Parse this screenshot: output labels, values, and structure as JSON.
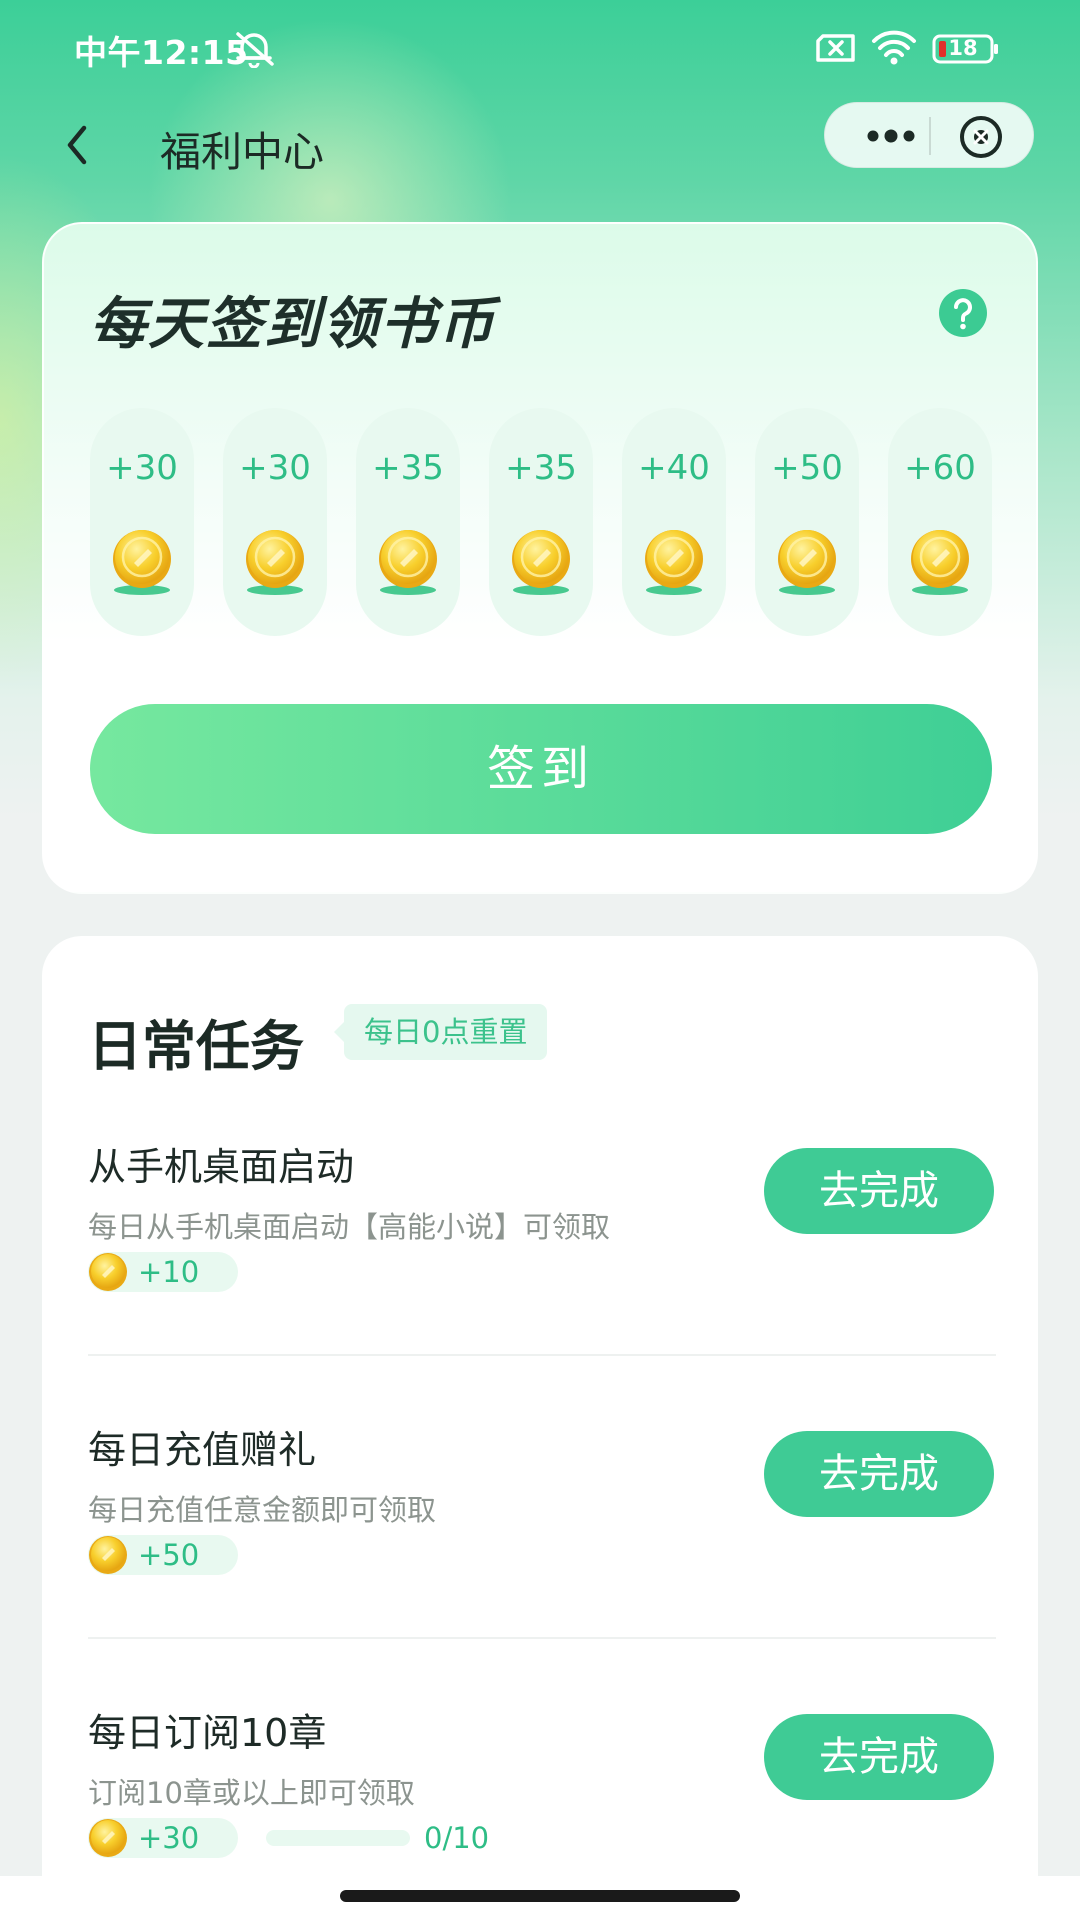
{
  "status_bar": {
    "time": "中午12:15",
    "battery": "18",
    "icons": [
      "bell-off-icon",
      "sim-x-icon",
      "wifi-icon",
      "battery-icon"
    ]
  },
  "nav": {
    "title": "福利中心",
    "back_icon": "chevron-left-icon",
    "more_icon": "more-dots-icon",
    "close_icon": "close-circle-icon"
  },
  "signin": {
    "title": "每天签到领书币",
    "help_icon": "question-circle-icon",
    "days": [
      {
        "value": "+30"
      },
      {
        "value": "+30"
      },
      {
        "value": "+35"
      },
      {
        "value": "+35"
      },
      {
        "value": "+40"
      },
      {
        "value": "+50"
      },
      {
        "value": "+60"
      }
    ],
    "button_label": "签到"
  },
  "tasks": {
    "title": "日常任务",
    "reset_badge": "每日0点重置",
    "items": [
      {
        "title": "从手机桌面启动",
        "desc": "每日从手机桌面启动【高能小说】可领取",
        "reward": "+10",
        "button_label": "去完成"
      },
      {
        "title": "每日充值赠礼",
        "desc": "每日充值任意金额即可领取",
        "reward": "+50",
        "button_label": "去完成"
      },
      {
        "title": "每日订阅10章",
        "desc": "订阅10章或以上即可领取",
        "reward": "+30",
        "button_label": "去完成",
        "progress_text": "0/10",
        "progress_fraction": 0
      }
    ]
  },
  "colors": {
    "accent": "#3fcb95",
    "accent_text": "#2ebd86",
    "coin": "#f5c422"
  }
}
